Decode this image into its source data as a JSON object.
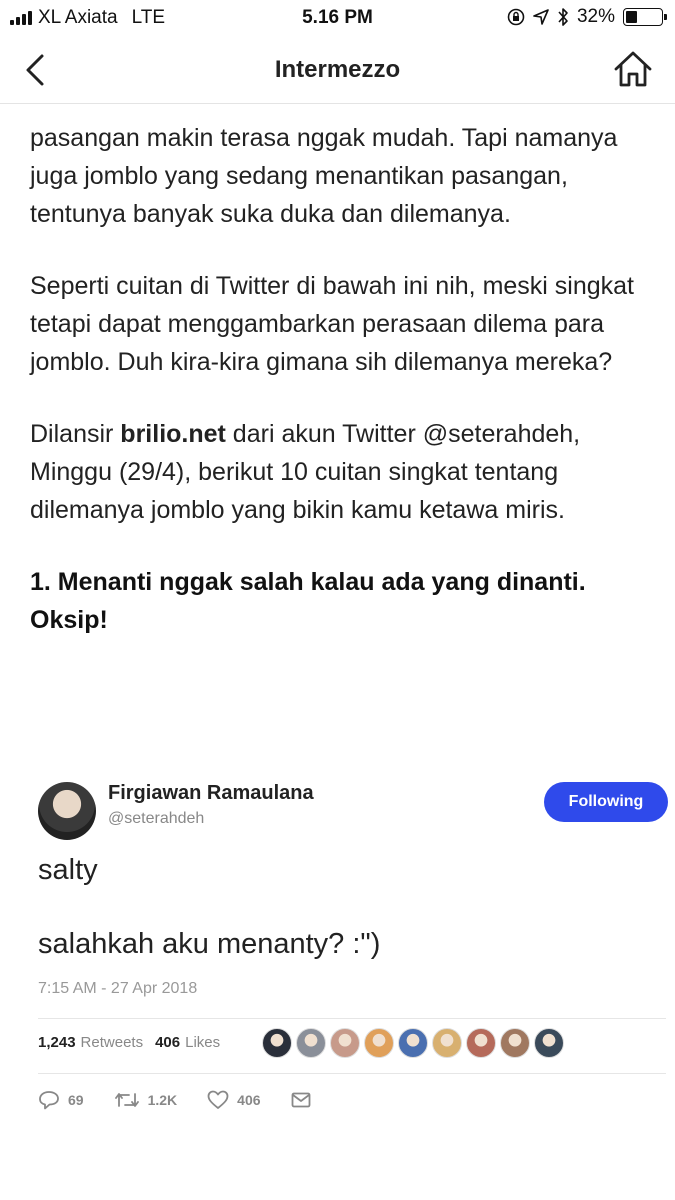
{
  "status_bar": {
    "carrier": "XL Axiata",
    "network": "LTE",
    "time": "5.16 PM",
    "battery": "32%",
    "battery_level": 0.32
  },
  "nav": {
    "title": "Intermezzo"
  },
  "article": {
    "paragraph1": "pasangan makin terasa nggak mudah. Tapi namanya juga jomblo yang sedang menantikan pasangan, tentunya banyak suka duka dan dilemanya.",
    "paragraph2": "Seperti cuitan di Twitter di bawah ini nih, meski singkat tetapi dapat menggambarkan perasaan dilema para jomblo. Duh kira-kira gimana sih dilemanya mereka?",
    "paragraph3_prefix": "Dilansir ",
    "paragraph3_bold": "brilio.net",
    "paragraph3_rest": " dari akun Twitter @seterahdeh, Minggu (29/4), berikut 10 cuitan singkat tentang dilemanya jomblo yang bikin kamu ketawa miris.",
    "heading": "1. Menanti nggak salah kalau ada yang dinanti. Oksip!"
  },
  "tweet": {
    "name": "Firgiawan Ramaulana",
    "handle": "@seterahdeh",
    "follow_label": "Following",
    "line1": "salty",
    "line2": "salahkah aku menanty? :\")",
    "timestamp": "7:15 AM - 27 Apr 2018",
    "retweets_count": "1,243",
    "retweets_label": "Retweets",
    "likes_count": "406",
    "likes_label": "Likes",
    "liker_colors": [
      "#2a2f3a",
      "#8a8f99",
      "#c79a8a",
      "#e0a05a",
      "#4a6fb0",
      "#d8b070",
      "#b56a5a",
      "#a07860",
      "#3a4a5a"
    ],
    "reply_count": "69",
    "retweet_count_short": "1.2K",
    "like_count_short": "406",
    "accent_color": "#2f4aeb"
  }
}
